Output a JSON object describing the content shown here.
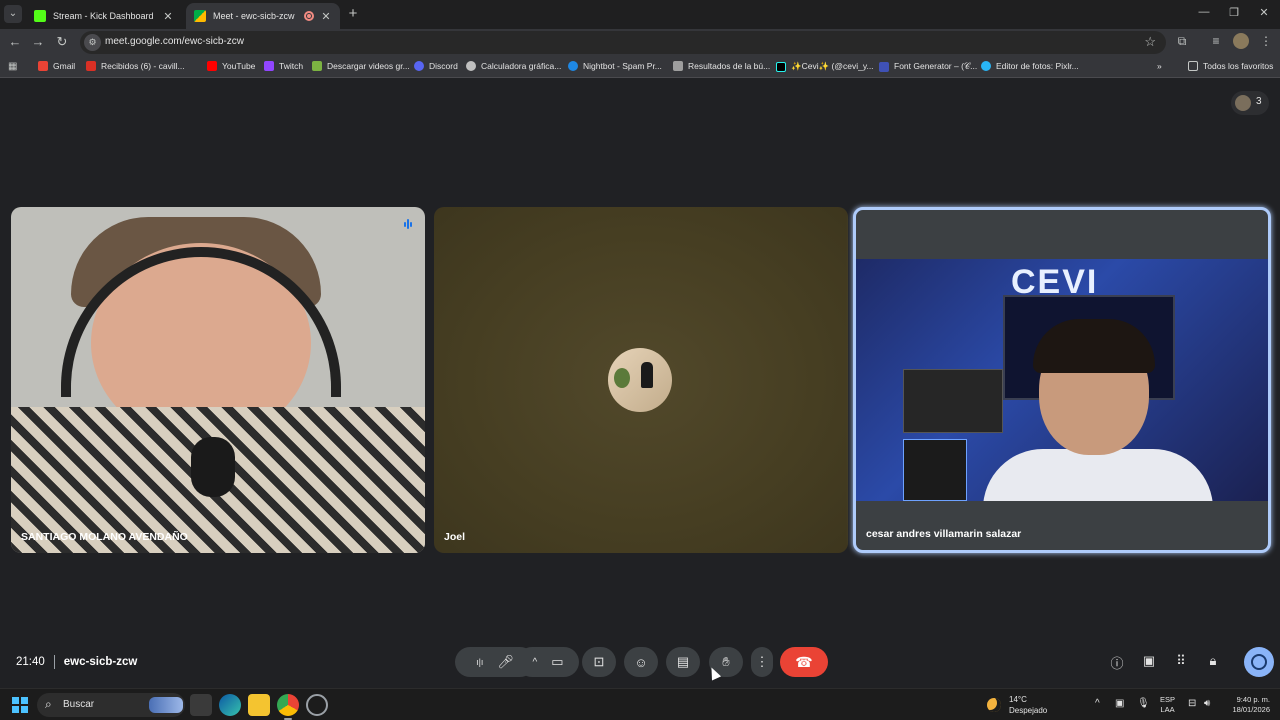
{
  "browser": {
    "tabs": [
      {
        "title": "Stream - Kick Dashboard",
        "favicon_color": "#53fc18"
      },
      {
        "title": "Meet - ewc-sicb-zcw",
        "favicon_color": "#00ac47",
        "recording": true
      }
    ],
    "new_tab_label": "+",
    "url": "meet.google.com/ewc-sicb-zcw",
    "bookmarks": [
      {
        "label": "Gmail",
        "color": "#ea4335"
      },
      {
        "label": "Recibidos (6) - cavill...",
        "color": "#d93025"
      },
      {
        "label": "YouTube",
        "color": "#ff0000"
      },
      {
        "label": "Twitch",
        "color": "#9146ff"
      },
      {
        "label": "Descargar videos gr...",
        "color": "#7cb342"
      },
      {
        "label": "Discord",
        "color": "#5865f2"
      },
      {
        "label": "Calculadora gráfica...",
        "color": "#c0c0c0"
      },
      {
        "label": "Nightbot - Spam Pr...",
        "color": "#1e88e5"
      },
      {
        "label": "Resultados de la bú...",
        "color": "#9e9e9e"
      },
      {
        "label": "✨Cevi✨ (@cevi_y...",
        "color": "#000000"
      },
      {
        "label": "Font Generator – (𝒞...",
        "color": "#3f51b5"
      },
      {
        "label": "Editor de fotos: Pixlr...",
        "color": "#29b6f6"
      }
    ],
    "bookmarks_overflow": "»",
    "all_bookmarks_label": "Todos los favoritos"
  },
  "meet": {
    "participant_count": "3",
    "tiles": [
      {
        "name": "SANTIAGO MOLANO AVENDAÑO",
        "speaking": true
      },
      {
        "name": "Joel",
        "camera_off": true
      },
      {
        "name": "cesar andres villamarin salazar",
        "active_speaker_outline": true
      }
    ],
    "time": "21:40",
    "meeting_code": "ewc-sicb-zcw",
    "controls": {
      "audio_more": "ı|ı",
      "mic_icon": "mic-icon",
      "video_more": "^",
      "camera_icon": "camera-icon",
      "present_icon": "present-icon",
      "emoji_icon": "emoji-icon",
      "captions_icon": "captions-icon",
      "raise_hand_icon": "hand-icon",
      "more_icon": "more-vert-icon",
      "end_call_icon": "end-call-icon"
    },
    "right_controls": [
      "info-icon",
      "chat-icon",
      "activities-icon",
      "host-controls-icon"
    ]
  },
  "taskbar": {
    "search_placeholder": "Buscar",
    "weather_temp": "14°C",
    "weather_desc": "Despejado",
    "lang_line1": "ESP",
    "lang_line2": "LAA",
    "time": "9:40 p. m.",
    "date": "18/01/2026"
  }
}
